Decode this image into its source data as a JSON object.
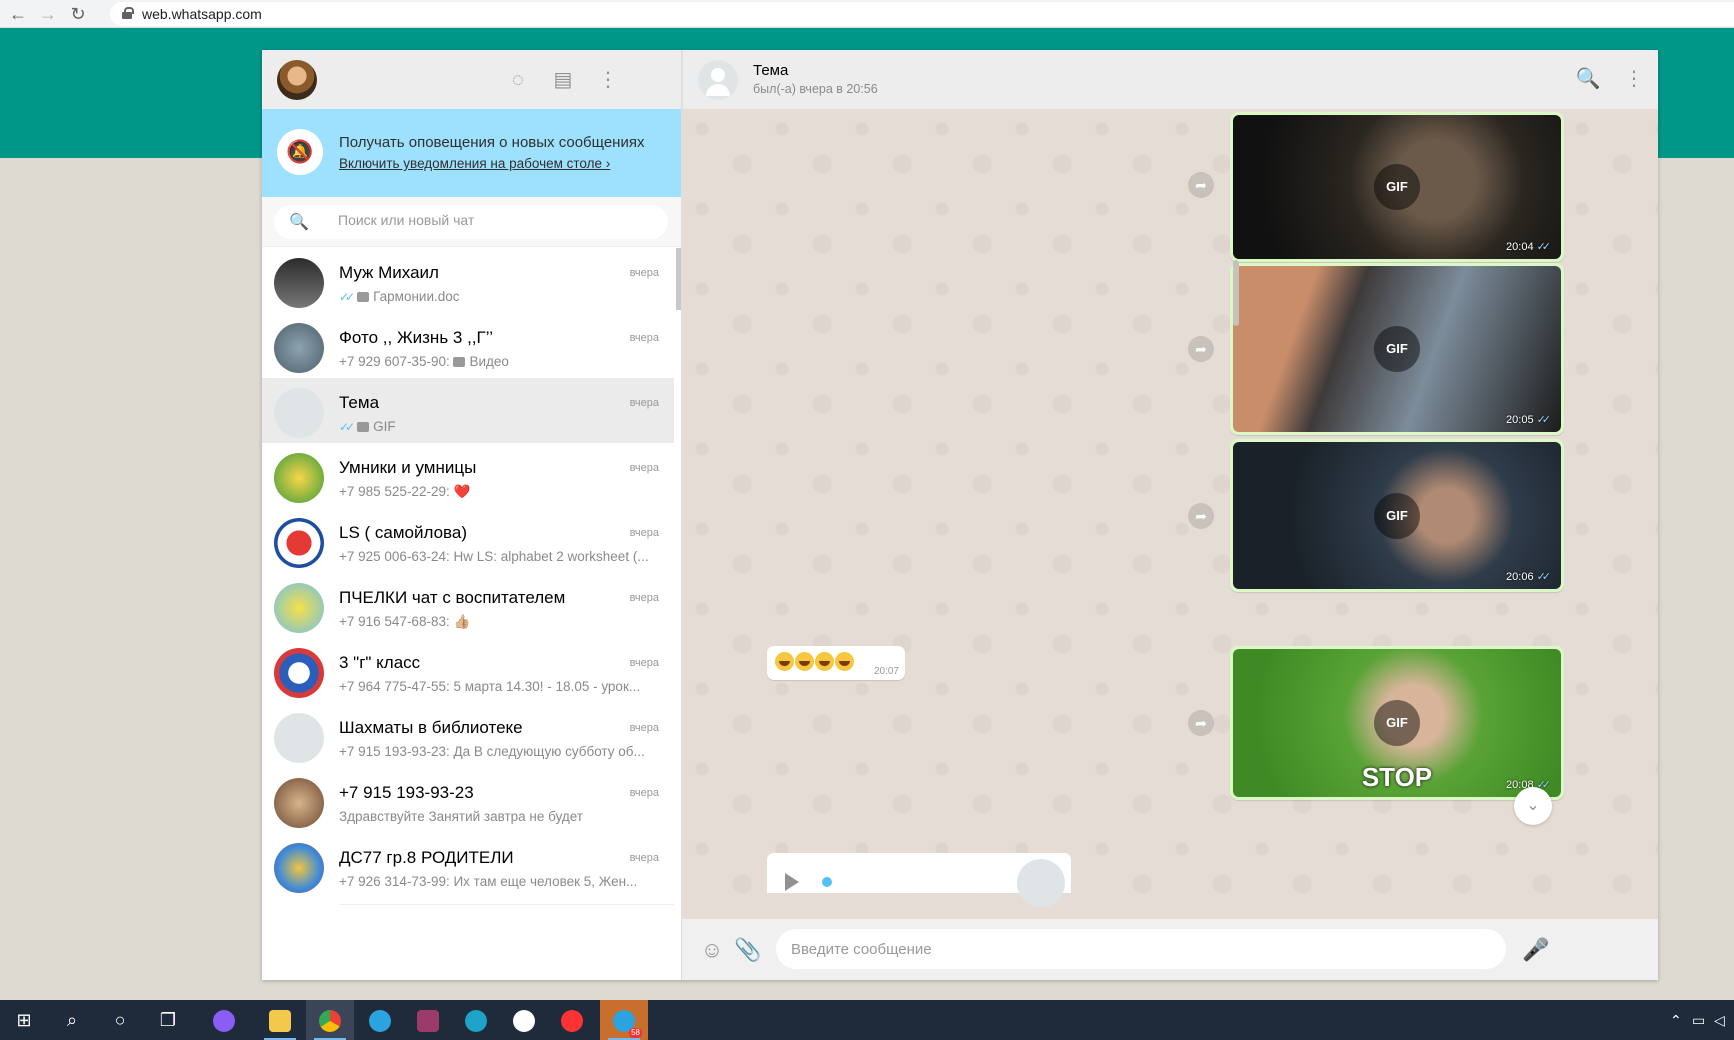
{
  "browser": {
    "url": "web.whatsapp.com"
  },
  "left": {
    "notification": {
      "title": "Получать оповещения о новых сообщениях",
      "link": "Включить уведомления на рабочем столе ›"
    },
    "search": {
      "placeholder": "Поиск или новый чат"
    },
    "chats": [
      {
        "name": "Муж Михаил",
        "time": "вчера",
        "preview": "Гармонии.doc",
        "ticks": "✓✓",
        "icon": "document-icon"
      },
      {
        "name": "Фото ,, Жизнь 3 ,,Г’’",
        "time": "вчера",
        "preview_prefix": "+7 929 607-35-90:",
        "preview": "Видео",
        "icon": "video-icon"
      },
      {
        "name": "Тема",
        "time": "вчера",
        "preview": "GIF",
        "ticks": "✓✓",
        "icon": "gif-icon",
        "active": true
      },
      {
        "name": "Умники и умницы",
        "time": "вчера",
        "preview": "+7 985 525-22-29:",
        "emoji": "❤️"
      },
      {
        "name": "LS ( самойлова)",
        "time": "вчера",
        "preview": "+7 925 006-63-24: Hw LS: alphabet 2 worksheet (..."
      },
      {
        "name": "ПЧЕЛКИ чат с воспитателем",
        "time": "вчера",
        "preview": "+7 916 547-68-83:",
        "emoji": "👍🏼"
      },
      {
        "name": "3 \"г\" класс",
        "time": "вчера",
        "preview": "+7 964 775-47-55: 5 марта 14.30! - 18.05 - урок..."
      },
      {
        "name": "Шахматы в библиотеке",
        "time": "вчера",
        "preview": "+7 915 193-93-23: Да В следующую субботу об..."
      },
      {
        "name": "+7 915 193-93-23",
        "time": "вчера",
        "preview": "Здравствуйте Занятий завтра не будет"
      },
      {
        "name": "ДС77 гр.8 РОДИТЕЛИ",
        "time": "вчера",
        "preview": "+7 926 314-73-99: Их там еще человек  5, Жен..."
      }
    ]
  },
  "chat": {
    "name": "Тема",
    "status": "был(-а) вчера в 20:56",
    "messages": [
      {
        "type": "gif",
        "label": "GIF",
        "time": "20:04",
        "ticks": "✓✓"
      },
      {
        "type": "gif",
        "label": "GIF",
        "time": "20:05",
        "ticks": "✓✓"
      },
      {
        "type": "gif",
        "label": "GIF",
        "time": "20:06",
        "ticks": "✓✓"
      },
      {
        "type": "text",
        "text": "😄😄😄😄",
        "time": "20:07"
      },
      {
        "type": "gif",
        "label": "GIF",
        "overlay_text": "STOP",
        "time": "20:08",
        "ticks": "✓✓"
      }
    ],
    "composer": {
      "placeholder": "Введите сообщение"
    }
  },
  "taskbar": {
    "telegram_badge": "58"
  },
  "colors": {
    "teal": "#009688",
    "notify_bg": "#9de1fe",
    "outgoing": "#dcf8c6",
    "chat_bg": "#e5ddd5",
    "tick_blue": "#4fc3f7"
  }
}
